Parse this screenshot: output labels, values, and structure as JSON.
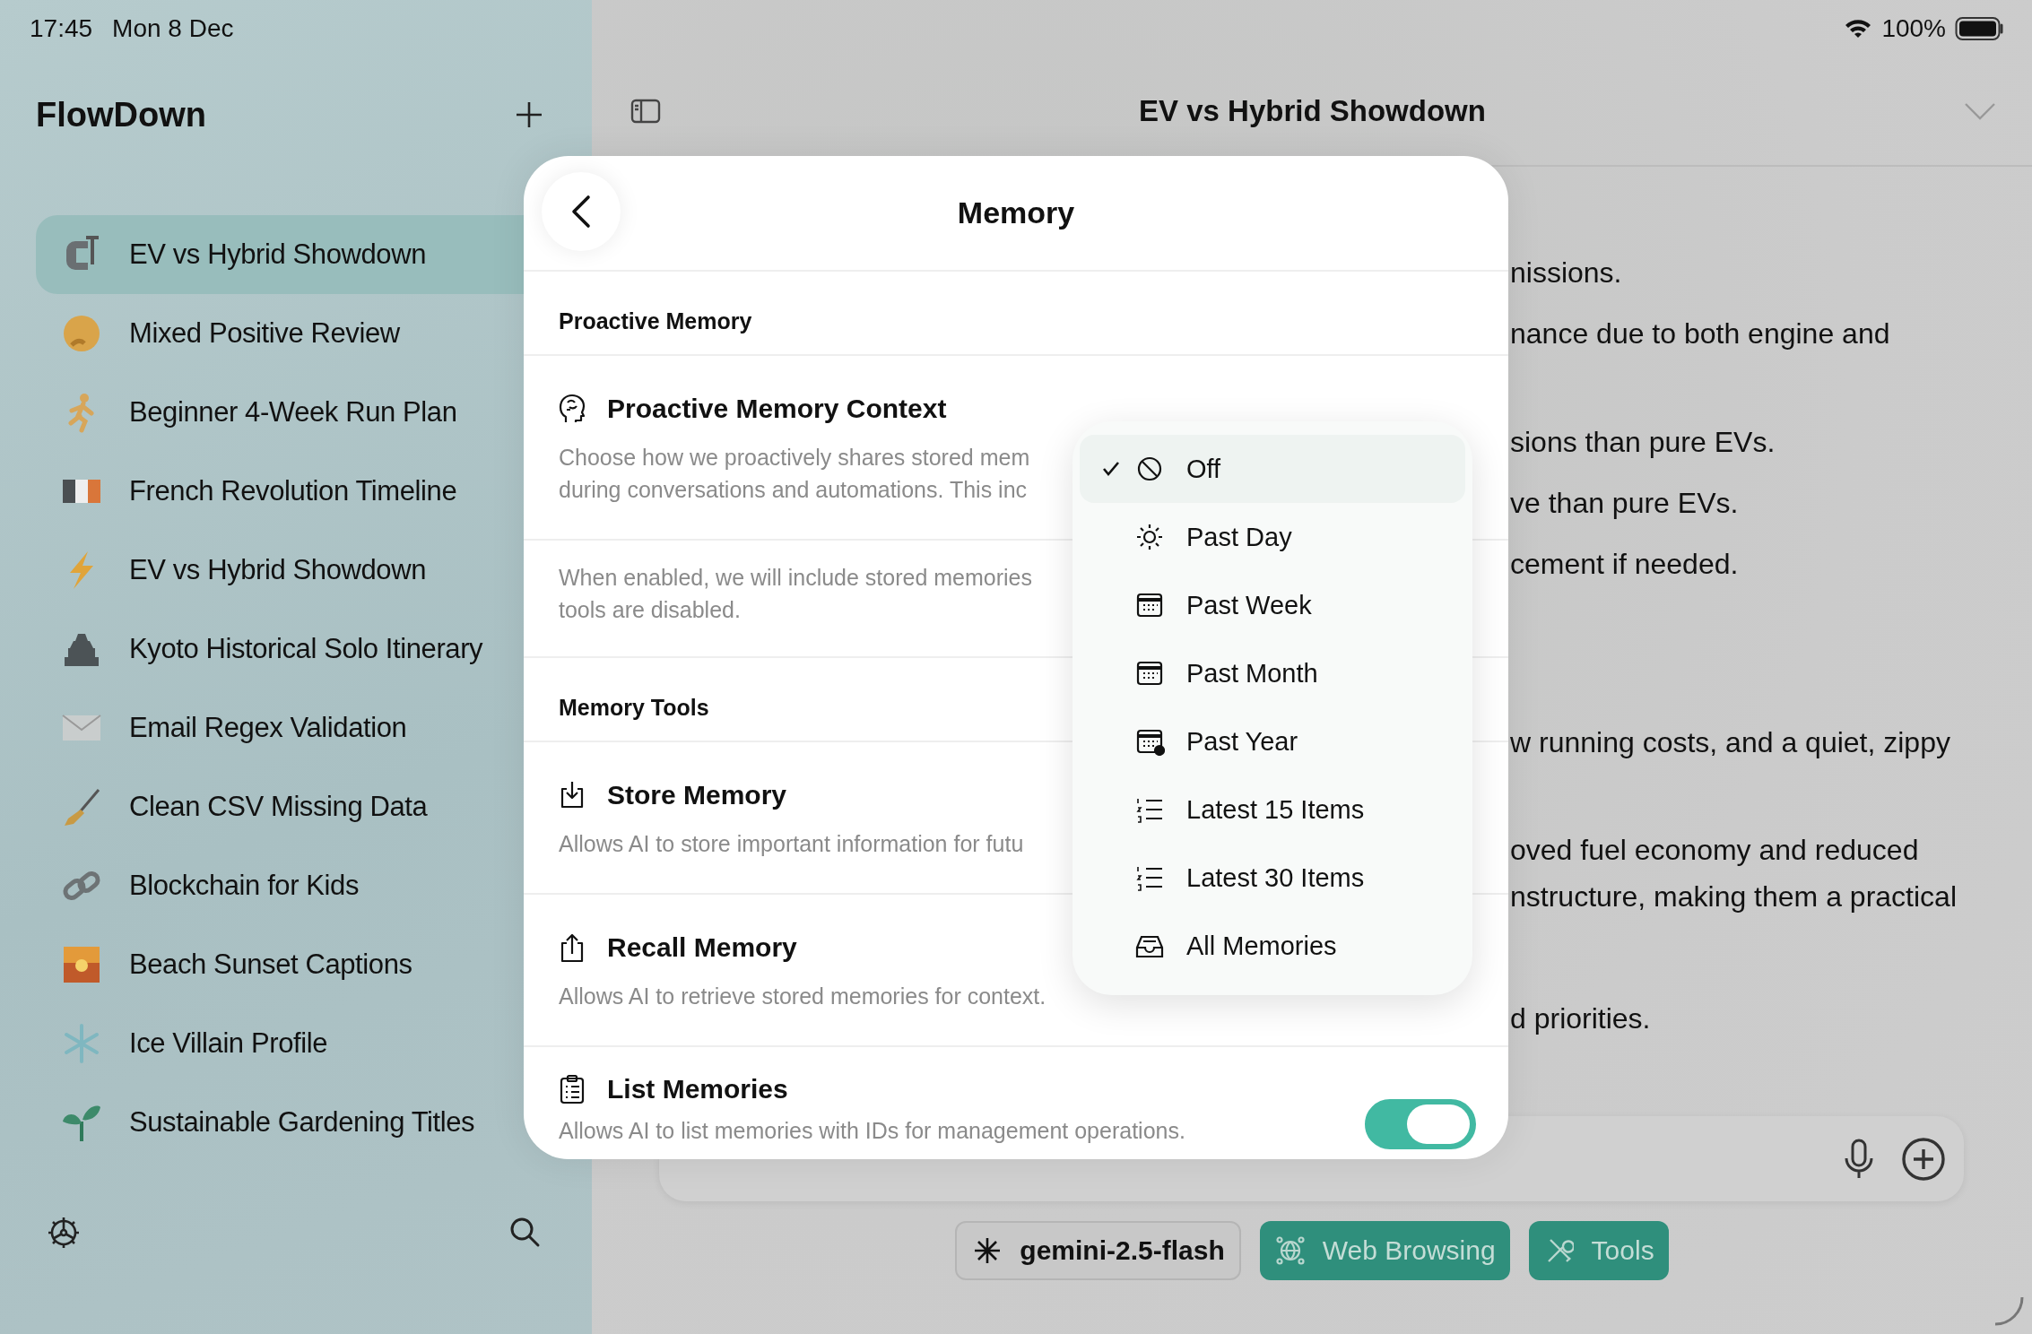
{
  "status_bar": {
    "time": "17:45",
    "date": "Mon 8 Dec",
    "battery": "100%"
  },
  "sidebar": {
    "title": "FlowDown",
    "items": [
      {
        "label": "EV vs Hybrid Showdown",
        "selected": true
      },
      {
        "label": "Mixed Positive Review",
        "selected": false
      },
      {
        "label": "Beginner 4-Week Run Plan",
        "selected": false
      },
      {
        "label": "French Revolution Timeline",
        "selected": false
      },
      {
        "label": "EV vs Hybrid Showdown",
        "selected": false
      },
      {
        "label": "Kyoto Historical Solo Itinerary",
        "selected": false
      },
      {
        "label": "Email Regex Validation",
        "selected": false
      },
      {
        "label": "Clean CSV Missing Data",
        "selected": false
      },
      {
        "label": "Blockchain for Kids",
        "selected": false
      },
      {
        "label": "Beach Sunset Captions",
        "selected": false
      },
      {
        "label": "Ice Villain Profile",
        "selected": false
      },
      {
        "label": "Sustainable Gardening Titles",
        "selected": false
      }
    ]
  },
  "header": {
    "title": "EV vs Hybrid Showdown"
  },
  "chat": {
    "lines": [
      "nissions.",
      "nance due to both engine and",
      "sions than pure EVs.",
      "ve than pure EVs.",
      "cement if needed.",
      "w running costs, and a quiet, zippy",
      "oved fuel economy and reduced",
      "nstructure, making them a practical",
      "d priorities."
    ]
  },
  "composer": {
    "chips": [
      {
        "label": "gemini-2.5-flash",
        "kind": "model"
      },
      {
        "label": "Web Browsing",
        "kind": "toggle",
        "on": true
      },
      {
        "label": "Tools",
        "kind": "toggle",
        "on": true
      }
    ]
  },
  "modal": {
    "title": "Memory",
    "sections": [
      {
        "heading": "Proactive Memory",
        "rows": [
          {
            "kind": "setting",
            "title": "Proactive Memory Context",
            "description": [
              "Choose how we proactively shares stored mem",
              "during conversations and automations. This inc"
            ]
          },
          {
            "kind": "note",
            "description": [
              "When enabled, we will include stored memories",
              "tools are disabled."
            ]
          }
        ]
      },
      {
        "heading": "Memory Tools",
        "rows": [
          {
            "kind": "setting",
            "title": "Store Memory",
            "description": [
              "Allows AI to store important information for futu"
            ]
          },
          {
            "kind": "setting",
            "title": "Recall Memory",
            "description": [
              "Allows AI to retrieve stored memories for context."
            ]
          },
          {
            "kind": "setting",
            "title": "List Memories",
            "description": [
              "Allows AI to list memories with IDs for management operations."
            ],
            "on": true
          }
        ]
      }
    ]
  },
  "menu": {
    "items": [
      {
        "label": "Off",
        "selected": true
      },
      {
        "label": "Past Day",
        "selected": false
      },
      {
        "label": "Past Week",
        "selected": false
      },
      {
        "label": "Past Month",
        "selected": false
      },
      {
        "label": "Past Year",
        "selected": false
      },
      {
        "label": "Latest 15 Items",
        "selected": false
      },
      {
        "label": "Latest 30 Items",
        "selected": false
      },
      {
        "label": "All Memories",
        "selected": false
      }
    ]
  }
}
